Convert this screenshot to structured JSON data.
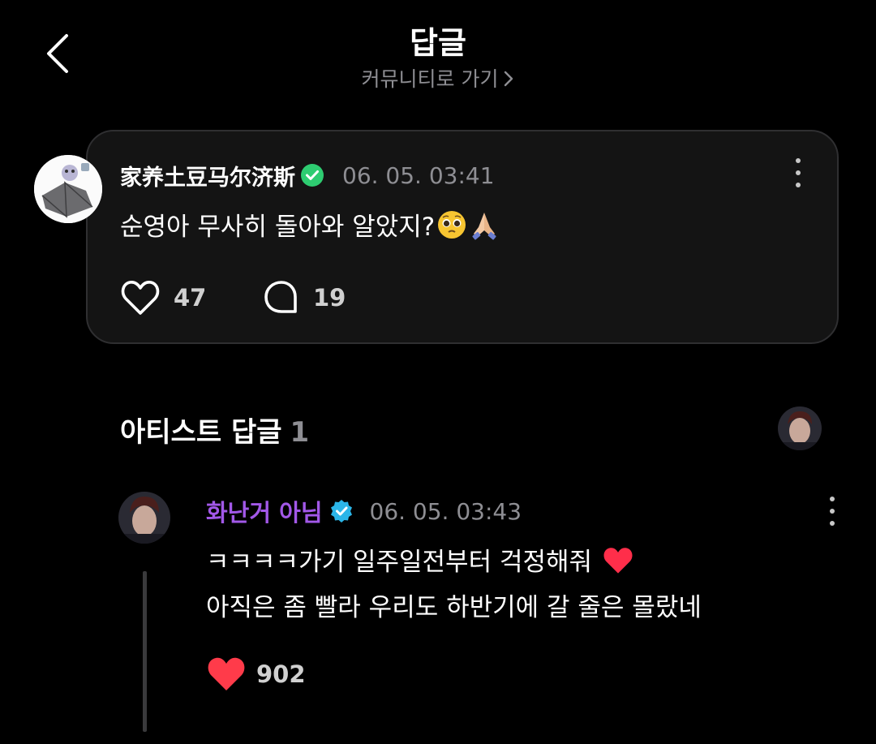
{
  "header": {
    "title": "답글",
    "community_link": "커뮤니티로 가기",
    "icons": {
      "back": "chevron-left-icon",
      "link": "chevron-right-icon"
    }
  },
  "post": {
    "author": "家养土豆马尔济斯",
    "timestamp": "06. 05. 03:41",
    "text": "순영아 무사히 돌아와 알았지?",
    "emojis": [
      "pleading-face-icon",
      "folded-hands-icon"
    ],
    "likes": "47",
    "comments": "19",
    "badge_color": "#2ecc71"
  },
  "artist_section": {
    "title": "아티스트 답글",
    "count": "1"
  },
  "reply": {
    "author": "화난거 아님",
    "timestamp": "06. 05. 03:43",
    "lines": [
      "ㅋㅋㅋㅋ가기 일주일전부터 걱정해줘",
      "아직은 좀 빨라 우리도 하반기에 갈 줄은 몰랐네"
    ],
    "likes": "902",
    "name_color": "#a258e8",
    "badge_color": "#2bb5e8",
    "heart_color": "#ff3b4a"
  }
}
